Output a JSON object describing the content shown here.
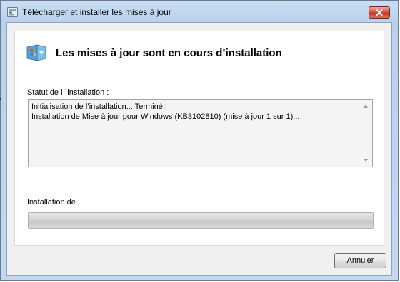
{
  "window": {
    "title": "Télécharger et installer les mises à jour",
    "icon": "windows-update-icon",
    "close_icon": "close-icon"
  },
  "header": {
    "title": "Les mises à jour sont en cours d’installation",
    "icon": "windows-update-shield-icon"
  },
  "status": {
    "label": "Statut de l ´installation :",
    "log_lines": [
      "Initialisation de l’installation... Terminé !",
      "Installation de Mise à jour pour Windows (KB3102810) (mise à jour 1 sur 1)..."
    ]
  },
  "installation": {
    "label": "Installation de  :",
    "progress": 0
  },
  "buttons": {
    "cancel_label": "Annuler"
  },
  "colors": {
    "title_bar": "#c9def4",
    "close_button": "#c23a22",
    "progress_track": "#d4d4d4",
    "progress_fill": "#3fbf2f"
  }
}
